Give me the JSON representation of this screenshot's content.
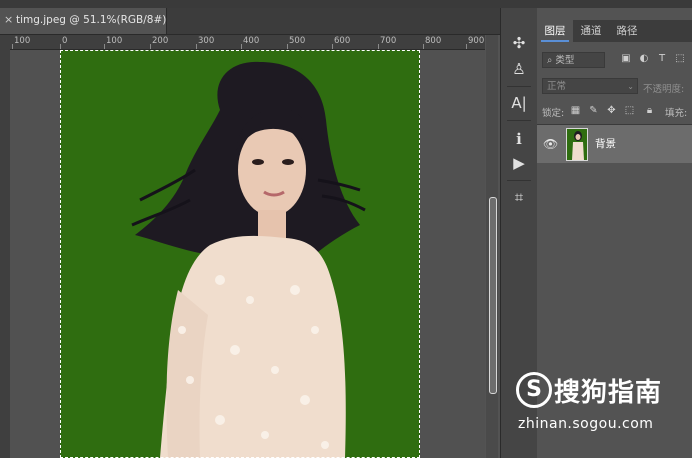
{
  "document": {
    "tab_title": "timg.jpeg @ 51.1%(RGB/8#)",
    "close_glyph": "×"
  },
  "ruler": {
    "labels": [
      "100",
      "0",
      "100",
      "200",
      "300",
      "400",
      "500",
      "600",
      "700",
      "800",
      "900"
    ]
  },
  "canvas": {
    "background_color": "#2f6d10",
    "content": "portrait-photo"
  },
  "toolstrip": {
    "collapse_glyph": "«",
    "tools": [
      {
        "name": "puzzle-icon",
        "glyph": "✣"
      },
      {
        "name": "stamp-icon",
        "glyph": "♙"
      },
      {
        "name": "character-icon",
        "glyph": "A|"
      },
      {
        "name": "info-icon",
        "glyph": "ℹ"
      },
      {
        "name": "play-icon",
        "glyph": "▶"
      },
      {
        "name": "crop-icon",
        "glyph": "⌗"
      }
    ]
  },
  "layers_panel": {
    "tabs": [
      {
        "label": "图层",
        "active": true
      },
      {
        "label": "通道",
        "active": false
      },
      {
        "label": "路径",
        "active": false
      }
    ],
    "kind_filter": "⌕ 类型",
    "blend_mode": "正常",
    "opacity_label": "不透明度:",
    "lock_label": "锁定:",
    "fill_label": "填充:",
    "layers": [
      {
        "name": "背景",
        "visible": true
      }
    ]
  },
  "watermark": {
    "logo_glyph": "S",
    "brand": "搜狗指南",
    "url": "zhinan.sogou.com"
  }
}
